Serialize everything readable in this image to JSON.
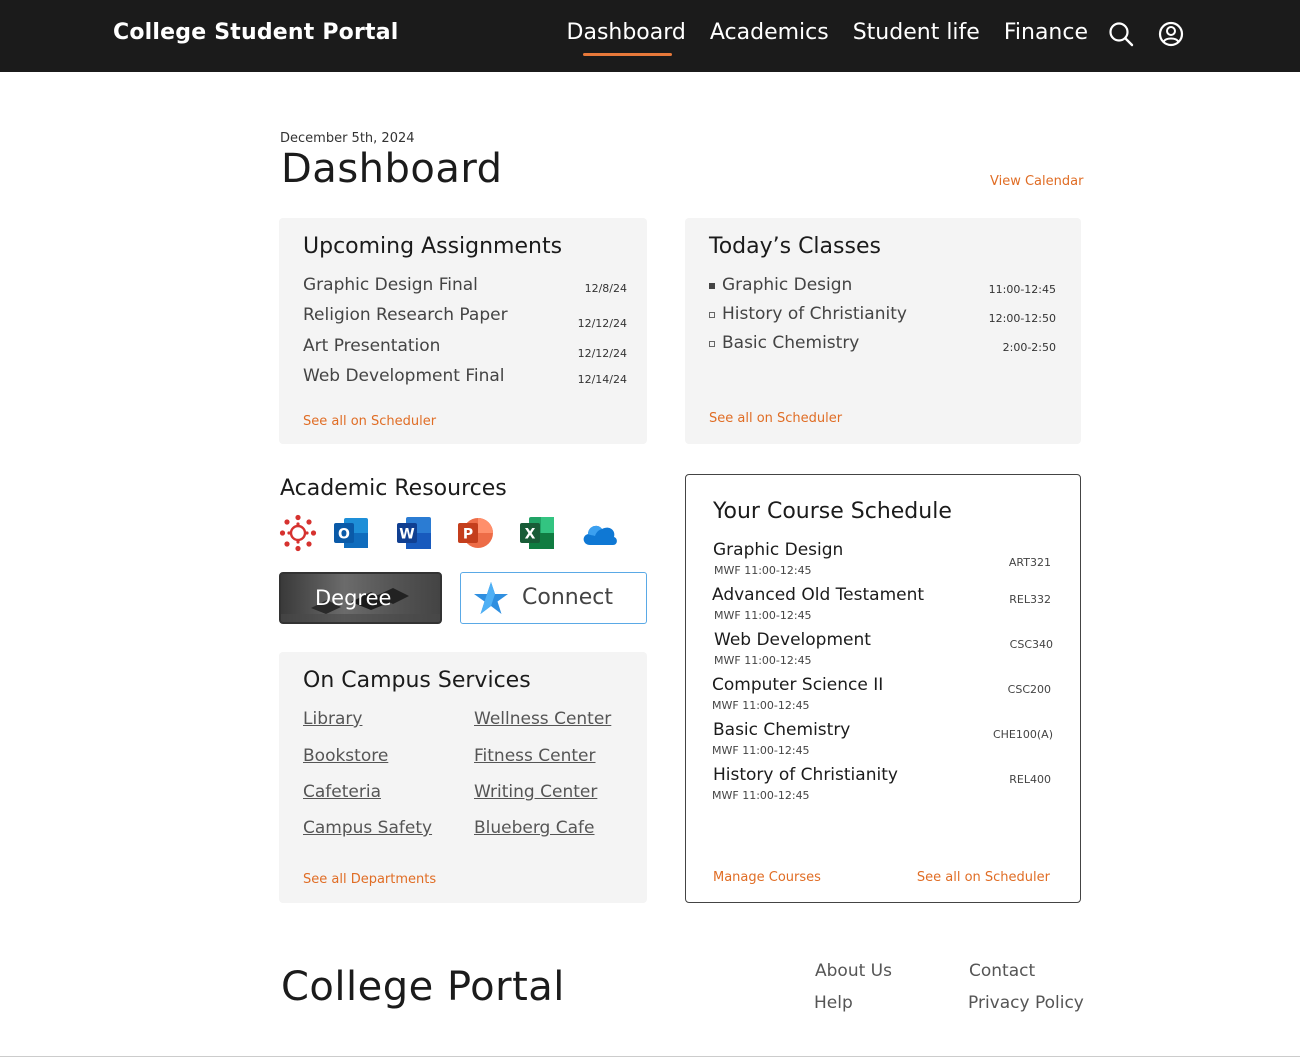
{
  "header": {
    "brand": "College Student Portal",
    "nav": [
      "Dashboard",
      "Academics",
      "Student life",
      "Finance"
    ],
    "active_nav": "Dashboard",
    "accent": "#e8793a",
    "icons": [
      "search-icon",
      "user-account-icon"
    ]
  },
  "page": {
    "date": "December 5th, 2024",
    "title": "Dashboard",
    "view_calendar": "View Calendar"
  },
  "assignments": {
    "title": "Upcoming Assignments",
    "items": [
      {
        "name": "Graphic Design Final",
        "due": "12/8/24"
      },
      {
        "name": "Religion Research Paper",
        "due": "12/12/24"
      },
      {
        "name": "Art Presentation",
        "due": "12/12/24"
      },
      {
        "name": "Web Development Final",
        "due": "12/14/24"
      }
    ],
    "see_all": "See all on Scheduler"
  },
  "classes": {
    "title": "Today’s Classes",
    "items": [
      {
        "name": "Graphic Design",
        "time": "11:00-12:45",
        "marker": "filled"
      },
      {
        "name": "History of Christianity",
        "time": "12:00-12:50",
        "marker": "open"
      },
      {
        "name": "Basic Chemistry",
        "time": "2:00-2:50",
        "marker": "open"
      }
    ],
    "see_all": "See all on Scheduler"
  },
  "resources": {
    "title": "Academic Resources",
    "apps": [
      "canvas-icon",
      "outlook-icon",
      "word-icon",
      "powerpoint-icon",
      "excel-icon",
      "onedrive-icon"
    ],
    "degree_label": "Degree",
    "connect_label": "Connect"
  },
  "campus": {
    "title": "On Campus Services",
    "left": [
      "Library",
      "Bookstore",
      "Cafeteria",
      "Campus Safety"
    ],
    "right": [
      "Wellness Center",
      "Fitness Center",
      "Writing Center",
      "Blueberg Cafe"
    ],
    "see_all": "See all Departments"
  },
  "schedule": {
    "title": "Your Course Schedule",
    "courses": [
      {
        "name": "Graphic Design",
        "time": "MWF 11:00-12:45",
        "code": "ART321"
      },
      {
        "name": "Advanced Old Testament",
        "time": "MWF 11:00-12:45",
        "code": "REL332"
      },
      {
        "name": "Web Development",
        "time": "MWF 11:00-12:45",
        "code": "CSC340"
      },
      {
        "name": "Computer Science II",
        "time": "MWF 11:00-12:45",
        "code": "CSC200"
      },
      {
        "name": "Basic Chemistry",
        "time": "MWF 11:00-12:45",
        "code": "CHE100(A)"
      },
      {
        "name": "History of Christianity",
        "time": "MWF 11:00-12:45",
        "code": "REL400"
      }
    ],
    "manage": "Manage Courses",
    "see_all": "See all on Scheduler"
  },
  "footer": {
    "title": "College Portal",
    "links": [
      "About Us",
      "Contact",
      "Help",
      "Privacy Policy"
    ]
  }
}
